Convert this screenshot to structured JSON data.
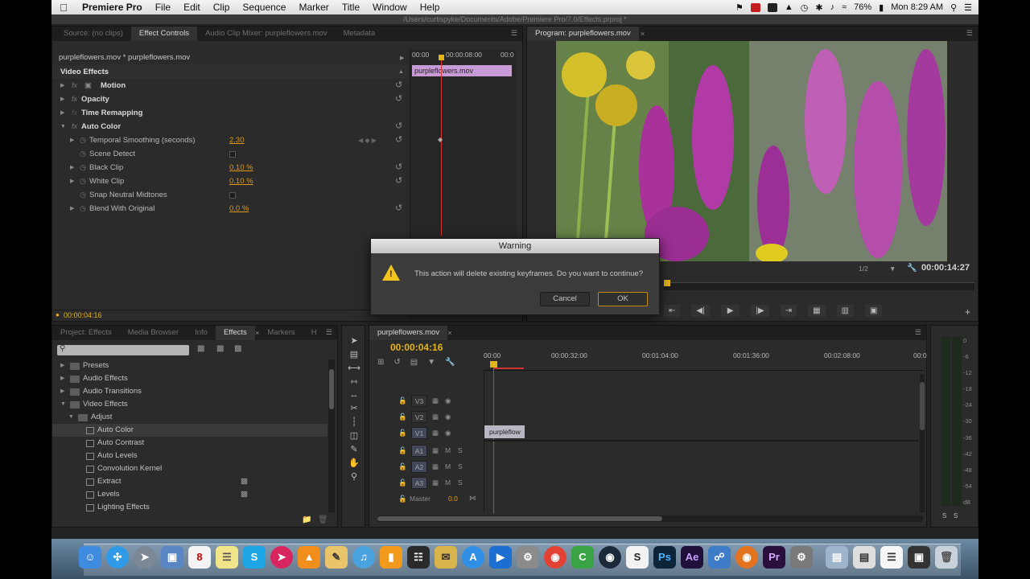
{
  "menubar": {
    "app_name": "Premiere Pro",
    "menus": [
      "File",
      "Edit",
      "Clip",
      "Sequence",
      "Marker",
      "Title",
      "Window",
      "Help"
    ],
    "battery": "76%",
    "clock": "Mon 8:29 AM"
  },
  "path_bar": "/Users/curtispyke/Documents/Adobe/Premiere Pro/7.0/Effects.prproj *",
  "source_tabs": [
    "Source: (no clips)",
    "Effect Controls",
    "Audio Clip Mixer: purpleflowers.mov",
    "Metadata"
  ],
  "effect_controls": {
    "clip_path": "purpleflowers.mov * purpleflowers.mov",
    "section_header": "Video Effects",
    "effects": [
      {
        "name": "Motion"
      },
      {
        "name": "Opacity"
      },
      {
        "name": "Time Remapping"
      },
      {
        "name": "Auto Color"
      }
    ],
    "params": [
      {
        "name": "Temporal Smoothing (seconds)",
        "value": "2.30",
        "kind": "value"
      },
      {
        "name": "Scene Detect",
        "value": "",
        "kind": "checkbox"
      },
      {
        "name": "Black Clip",
        "value": "0.10 %",
        "kind": "value"
      },
      {
        "name": "White Clip",
        "value": "0.10 %",
        "kind": "value"
      },
      {
        "name": "Snap Neutral Midtones",
        "value": "",
        "kind": "checkbox"
      },
      {
        "name": "Blend With Original",
        "value": "0.0 %",
        "kind": "value"
      }
    ],
    "mini_timeline": {
      "start": "00:00",
      "mid": "00:00:08:00",
      "end": "00:0"
    },
    "clip_label": "purpleflowers.mov",
    "current_time": "00:00:04:16"
  },
  "program": {
    "tab": "Program: purpleflowers.mov",
    "zoom": "1/2",
    "timecode": "00:00:14:27"
  },
  "dialog": {
    "title": "Warning",
    "message": "This action will delete existing keyframes. Do you want to continue?",
    "cancel": "Cancel",
    "ok": "OK"
  },
  "project": {
    "tabs": [
      "Project: Effects",
      "Media Browser",
      "Info",
      "Effects",
      "Markers",
      "H"
    ],
    "tree": [
      {
        "label": "Presets",
        "kind": "folder",
        "indent": 0
      },
      {
        "label": "Audio Effects",
        "kind": "folder",
        "indent": 0
      },
      {
        "label": "Audio Transitions",
        "kind": "folder",
        "indent": 0
      },
      {
        "label": "Video Effects",
        "kind": "folder",
        "indent": 0
      },
      {
        "label": "Adjust",
        "kind": "folder",
        "indent": 1
      },
      {
        "label": "Auto Color",
        "kind": "effect",
        "indent": 2
      },
      {
        "label": "Auto Contrast",
        "kind": "effect",
        "indent": 2
      },
      {
        "label": "Auto Levels",
        "kind": "effect",
        "indent": 2
      },
      {
        "label": "Convolution Kernel",
        "kind": "effect",
        "indent": 2
      },
      {
        "label": "Extract",
        "kind": "effect",
        "indent": 2
      },
      {
        "label": "Levels",
        "kind": "effect",
        "indent": 2
      },
      {
        "label": "Lighting Effects",
        "kind": "effect",
        "indent": 2
      }
    ]
  },
  "timeline": {
    "tab": "purpleflowers.mov",
    "timecode": "00:00:04:16",
    "ruler": [
      "00:00",
      "00:00:32:00",
      "00:01:04:00",
      "00:01:36:00",
      "00:02:08:00",
      "00:0"
    ],
    "video_tracks": [
      "V3",
      "V2",
      "V1"
    ],
    "audio_tracks": [
      "A1",
      "A2",
      "A3"
    ],
    "master_label": "Master",
    "master_value": "0.0",
    "clip_label": "purpleflow",
    "m_label": "M",
    "s_label": "S"
  },
  "meter": {
    "scale": [
      "0",
      "-6",
      "-12",
      "-18",
      "-24",
      "-30",
      "-36",
      "-42",
      "-48",
      "-54",
      "dB"
    ],
    "bottom": [
      "S",
      "S"
    ]
  },
  "dock": {
    "icons": [
      "finder-icon",
      "safari-icon",
      "launchpad-icon",
      "preview-icon",
      "calendar-icon",
      "notes-icon",
      "skype-icon",
      "pdf-icon",
      "vlc-icon",
      "toolbox-icon",
      "itunes-icon",
      "ibooks-icon",
      "rss-icon",
      "stickies-icon",
      "appstore-icon",
      "screenflow-icon",
      "system-preferences-icon",
      "chrome-icon",
      "camtasia-icon",
      "mission-control-icon",
      "scrivener-icon",
      "photoshop-icon",
      "after-effects-icon",
      "network-icon",
      "firefox-icon",
      "premiere-icon",
      "settings-icon",
      "finder-window-icon",
      "print-icon",
      "textedit-icon",
      "display-icon",
      "trash-icon"
    ],
    "labels": {
      "photoshop": "Ps",
      "after_effects": "Ae",
      "premiere": "Pr",
      "skype": "S",
      "camtasia": "C"
    }
  }
}
